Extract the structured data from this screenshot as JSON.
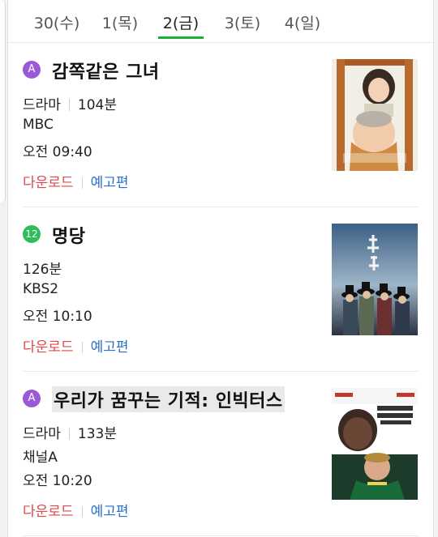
{
  "tabs": [
    {
      "label": "30(수)",
      "active": false
    },
    {
      "label": "1(목)",
      "active": false
    },
    {
      "label": "2(금)",
      "active": true
    },
    {
      "label": "3(토)",
      "active": false
    },
    {
      "label": "4(일)",
      "active": false
    }
  ],
  "colors": {
    "tab_active_underline": "#18b23a",
    "rating_all": "#9b59d6",
    "rating_12": "#2ebd59",
    "download": "#e0484a",
    "trailer": "#2a6fc9"
  },
  "programs": [
    {
      "rating": "A",
      "title": "감쪽같은 그녀",
      "genre": "드라마",
      "runtime": "104분",
      "channel": "MBC",
      "time": "오전 09:40",
      "download_label": "다운로드",
      "trailer_label": "예고편",
      "poster_icon": "movie-poster",
      "poster_title": "감쪽같은 그녀"
    },
    {
      "rating": "12",
      "title": "명당",
      "genre": "",
      "runtime": "126분",
      "channel": "KBS2",
      "time": "오전 10:10",
      "download_label": "다운로드",
      "trailer_label": "예고편",
      "poster_icon": "movie-poster",
      "poster_title": "명당"
    },
    {
      "rating": "A",
      "title": "우리가 꿈꾸는 기적: 인빅터스",
      "genre": "드라마",
      "runtime": "133분",
      "channel": "채널A",
      "time": "오전 10:20",
      "download_label": "다운로드",
      "trailer_label": "예고편",
      "poster_icon": "movie-poster",
      "poster_title": "우리가 꿈꾸는 기적 인빅터스"
    }
  ]
}
